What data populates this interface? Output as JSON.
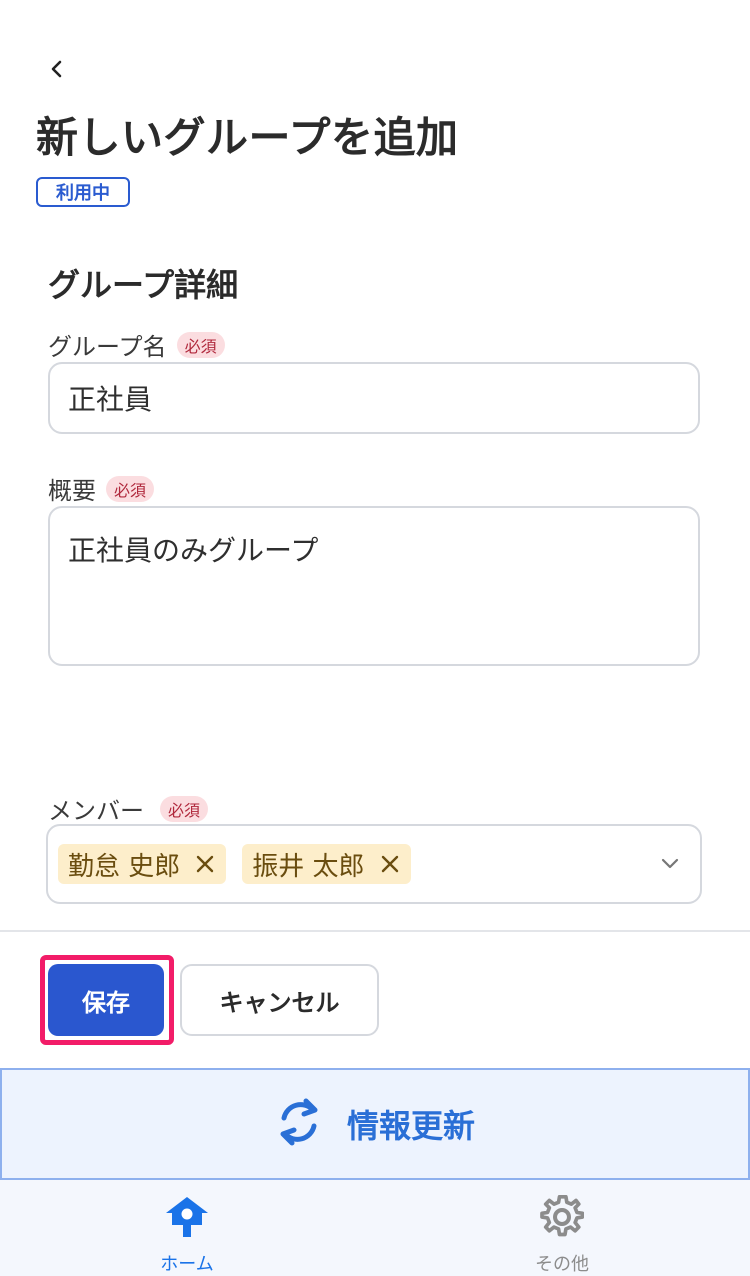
{
  "header": {
    "title": "新しいグループを追加",
    "status_badge": "利用中"
  },
  "section": {
    "title": "グループ詳細"
  },
  "form": {
    "required_label": "必須",
    "group_name": {
      "label": "グループ名",
      "value": "正社員"
    },
    "summary": {
      "label": "概要",
      "value": "正社員のみグループ"
    },
    "members": {
      "label": "メンバー",
      "selected": [
        "勤怠 史郎",
        "振井 太郎"
      ]
    }
  },
  "actions": {
    "save_label": "保存",
    "cancel_label": "キャンセル"
  },
  "refresh": {
    "label": "情報更新"
  },
  "bottom_nav": {
    "items": [
      {
        "label": "ホーム",
        "icon": "home-icon",
        "active": true
      },
      {
        "label": "その他",
        "icon": "gear-icon",
        "active": false
      }
    ]
  },
  "colors": {
    "primary": "#2a57cf",
    "accent_link": "#2a6fd6",
    "highlight": "#f21c68",
    "required_badge_bg": "#fbdde0",
    "chip_bg": "#fdeecb",
    "nav_active": "#1a73e8",
    "nav_inactive": "#8c8c8c"
  }
}
